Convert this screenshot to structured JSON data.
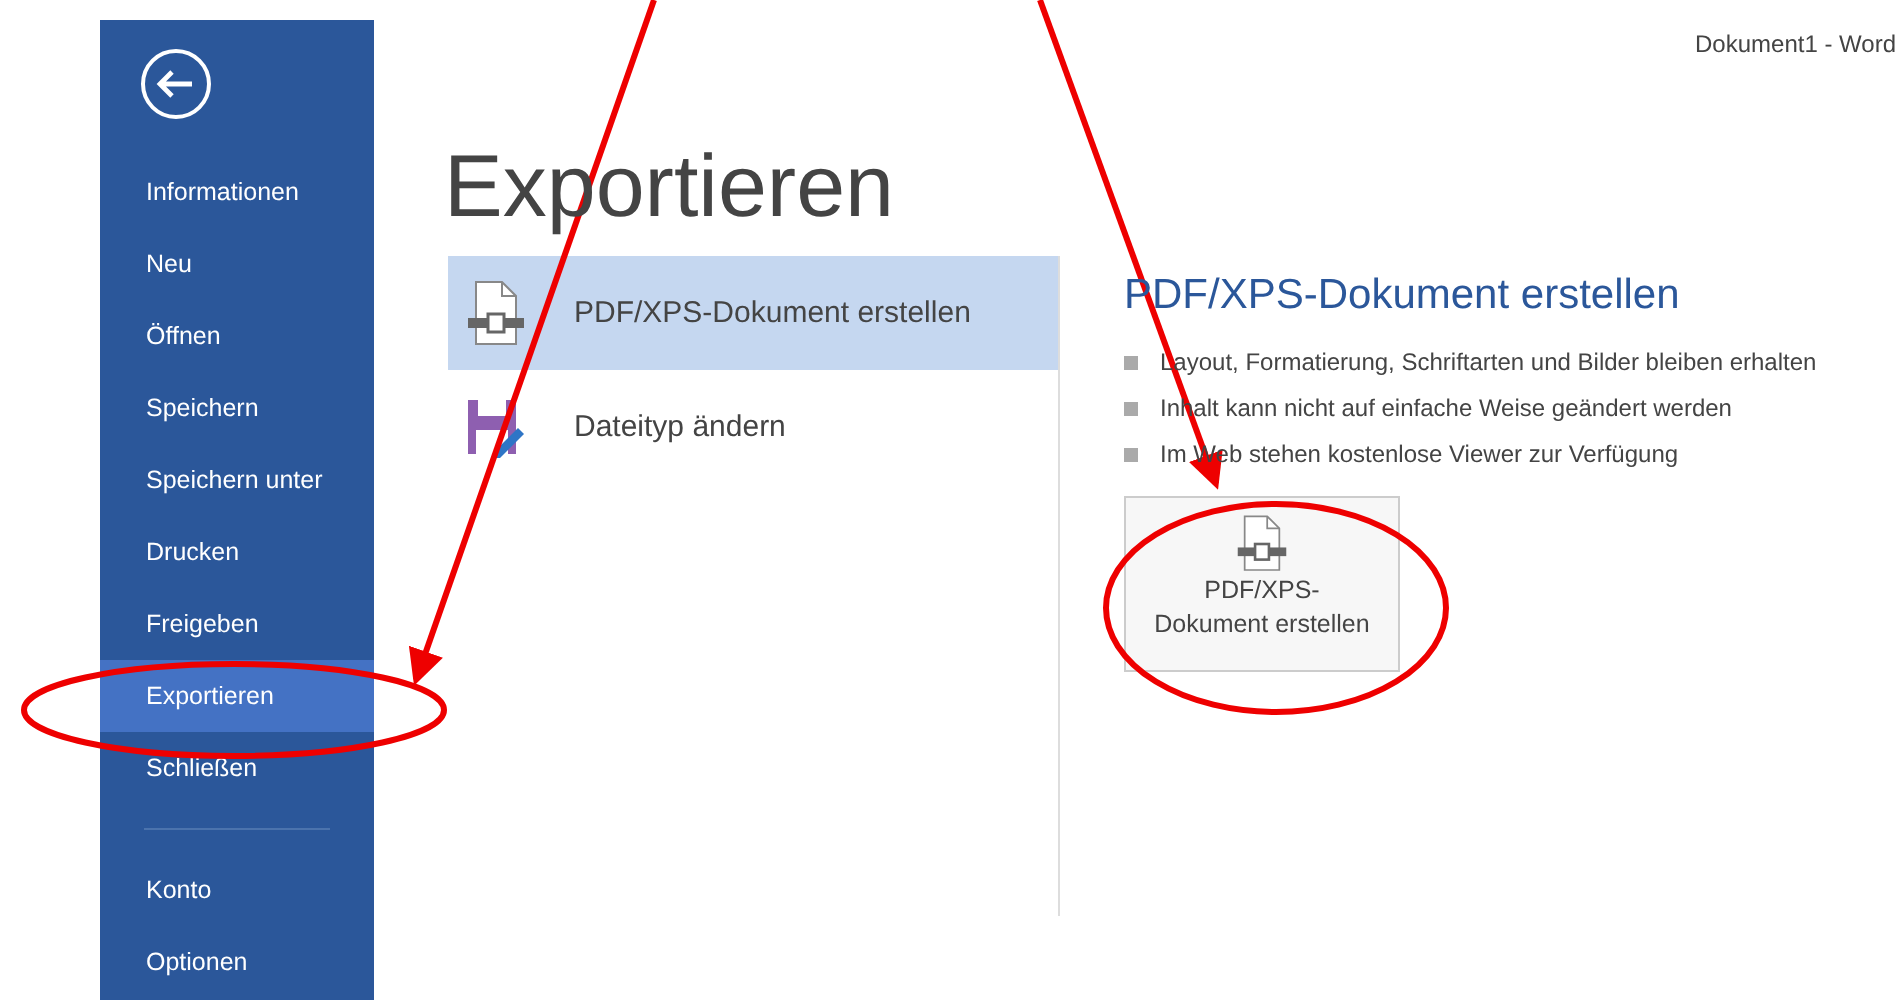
{
  "window": {
    "title": "Dokument1 - Word"
  },
  "sidebar": {
    "items": [
      {
        "label": "Informationen",
        "selected": false
      },
      {
        "label": "Neu",
        "selected": false
      },
      {
        "label": "Öffnen",
        "selected": false
      },
      {
        "label": "Speichern",
        "selected": false
      },
      {
        "label": "Speichern unter",
        "selected": false
      },
      {
        "label": "Drucken",
        "selected": false
      },
      {
        "label": "Freigeben",
        "selected": false
      },
      {
        "label": "Exportieren",
        "selected": true
      },
      {
        "label": "Schließen",
        "selected": false
      },
      {
        "kind": "divider"
      },
      {
        "label": "Konto",
        "selected": false
      },
      {
        "label": "Optionen",
        "selected": false
      }
    ]
  },
  "page_title": "Exportieren",
  "options": [
    {
      "label": "PDF/XPS-Dokument erstellen",
      "kind": "pdf",
      "selected": true
    },
    {
      "label": "Dateityp ändern",
      "kind": "filetype",
      "selected": false
    }
  ],
  "detail": {
    "heading": "PDF/XPS-Dokument erstellen",
    "bullets": [
      "Layout, Formatierung, Schriftarten und Bilder bleiben erhalten",
      "Inhalt kann nicht auf einfache Weise geändert werden",
      "Im Web stehen kostenlose Viewer zur Verfügung"
    ],
    "button": {
      "line_1": "PDF/XPS-",
      "line_2": "Dokument erstellen"
    }
  },
  "annotations": [
    {
      "kind": "arrow"
    },
    {
      "kind": "arrow"
    },
    {
      "kind": "ellipse"
    },
    {
      "kind": "ellipse"
    }
  ]
}
